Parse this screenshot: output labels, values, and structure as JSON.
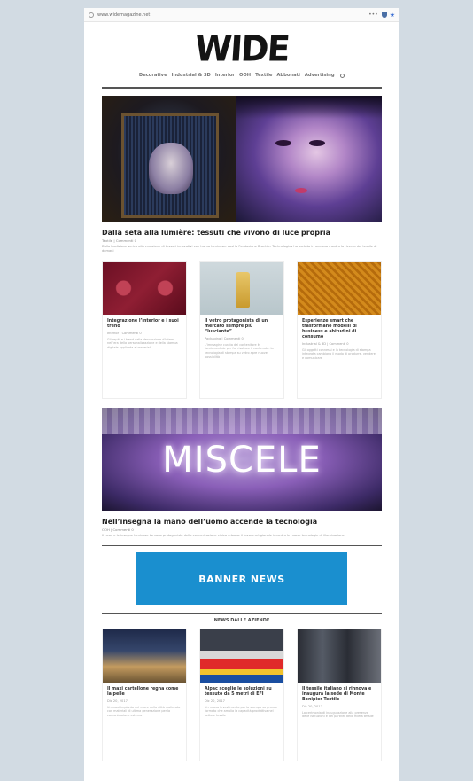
{
  "browser": {
    "url": "www.widemagazine.net",
    "menu_dots": "•••",
    "star": "★"
  },
  "logo": "WIDE",
  "nav": {
    "items": [
      "Decorative",
      "Industrial & 3D",
      "Interior",
      "OOH",
      "Textile",
      "Abbonati",
      "Advertising"
    ]
  },
  "featured": {
    "title": "Dalla seta alla lumière: tessuti che vivono di luce propria",
    "meta": "Textile | Commenti 0",
    "excerpt": "Dalla tradizione serica alla creazione di tessuti innovativi con trama luminosa: così la Fondazione Brochier Technologies ha portato in una sua mostra la ricerca del tessile di domani"
  },
  "cards": [
    {
      "title": "Integrazione l’interior e i suoi trend",
      "meta": "Interior | Commenti 0",
      "excerpt": "Gli ospiti e i trend della decorazione d’interni nell’era della personalizzazione e della stampa digitale applicata ai materiali"
    },
    {
      "title": "Il vetro protagonista di un mercato sempre più “lusciante”",
      "meta": "Packaging | Commenti 0",
      "excerpt": "L’immagine curata del contenitore è fondamentale per far risaltare il contenuto: la tecnologia di stampa su vetro apre nuove possibilità"
    },
    {
      "title": "Esperienze smart che trasformano modelli di business e abitudini di consumo",
      "meta": "Industrial & 3D | Commenti 0",
      "excerpt": "Gli oggetti connessi e la tecnologia di stampa integrata cambiano il modo di produrre, vendere e comunicare"
    }
  ],
  "second_featured": {
    "sign": "MISCELE",
    "title": "Nell’insegna la mano dell’uomo accende la tecnologia",
    "meta": "OOH | Commenti 0",
    "excerpt": "Il neon e le insegne luminose tornano protagoniste della comunicazione visiva urbana: il lavoro artigianale incontra le nuove tecnologie di illuminazione"
  },
  "banner": "BANNER NEWS",
  "news_section": "NEWS DALLE AZIENDE",
  "news": [
    {
      "title": "Il maxi cartellone regna come la pelle",
      "meta": "Dic 20, 2017",
      "excerpt": "Un maxi impianto nel cuore della città realizzato con materiali di ultima generazione per la comunicazione esterna"
    },
    {
      "title": "Alpac sceglie le soluzioni su tessuto da 5 metri di EFI",
      "meta": "Dic 20, 2017",
      "excerpt": "Un nuovo investimento per la stampa su grande formato che amplia la capacità produttiva nel settore tessile"
    },
    {
      "title": "Il tessile italiano si rinnova e inaugura la sede di Monte Bonipier Textile",
      "meta": "Dic 20, 2017",
      "excerpt": "La cerimonia di inaugurazione alla presenza delle istituzioni e dei partner della filiera tessile"
    }
  ]
}
